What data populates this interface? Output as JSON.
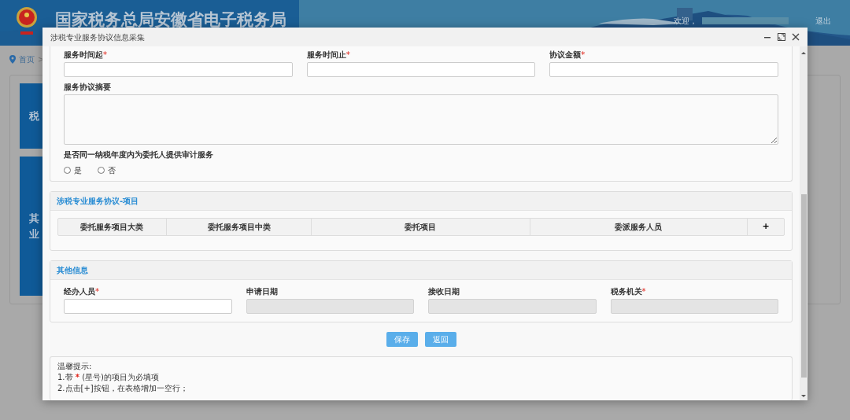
{
  "header": {
    "title": "国家税务总局安徽省电子税务局",
    "welcome": "欢迎，",
    "logout": "退出"
  },
  "breadcrumb": {
    "home": "首页",
    "separator": ">"
  },
  "tiles": [
    {
      "lines": [
        "税"
      ]
    },
    {
      "lines": [
        "其",
        "业"
      ]
    }
  ],
  "dialog": {
    "title": "涉税专业服务协议信息采集"
  },
  "agreement": {
    "fields": [
      {
        "label": "服务时间起",
        "required_mark": "*"
      },
      {
        "label": "服务时间止",
        "required_mark": "*"
      },
      {
        "label": "协议金额",
        "required_mark": "*"
      }
    ],
    "summary": {
      "label": "服务协议摘要"
    },
    "audit": {
      "question": "是否同一纳税年度内为委托人提供审计服务",
      "options": [
        {
          "label": "是",
          "selected": false
        },
        {
          "label": "否",
          "selected": false
        }
      ]
    }
  },
  "items": {
    "title": "涉税专业服务协议-项目",
    "columns": [
      "委托服务项目大类",
      "委托服务项目中类",
      "委托项目",
      "委派服务人员"
    ],
    "add": "+"
  },
  "other": {
    "title": "其他信息",
    "fields": [
      {
        "label": "经办人员",
        "required_mark": "*",
        "disabled": false
      },
      {
        "label": "申请日期",
        "disabled": true
      },
      {
        "label": "接收日期",
        "disabled": true
      },
      {
        "label": "税务机关",
        "required_mark": "*",
        "disabled": true
      }
    ]
  },
  "buttons": [
    {
      "label": "保存"
    },
    {
      "label": "返回"
    }
  ],
  "notes": {
    "title": "温馨提示:",
    "lines": [
      {
        "text": "1.带 ",
        "star": "*",
        "rest": " (星号)的项目为必填项"
      },
      {
        "text": "2.点击[+]按钮，在表格增加一空行；"
      }
    ]
  }
}
